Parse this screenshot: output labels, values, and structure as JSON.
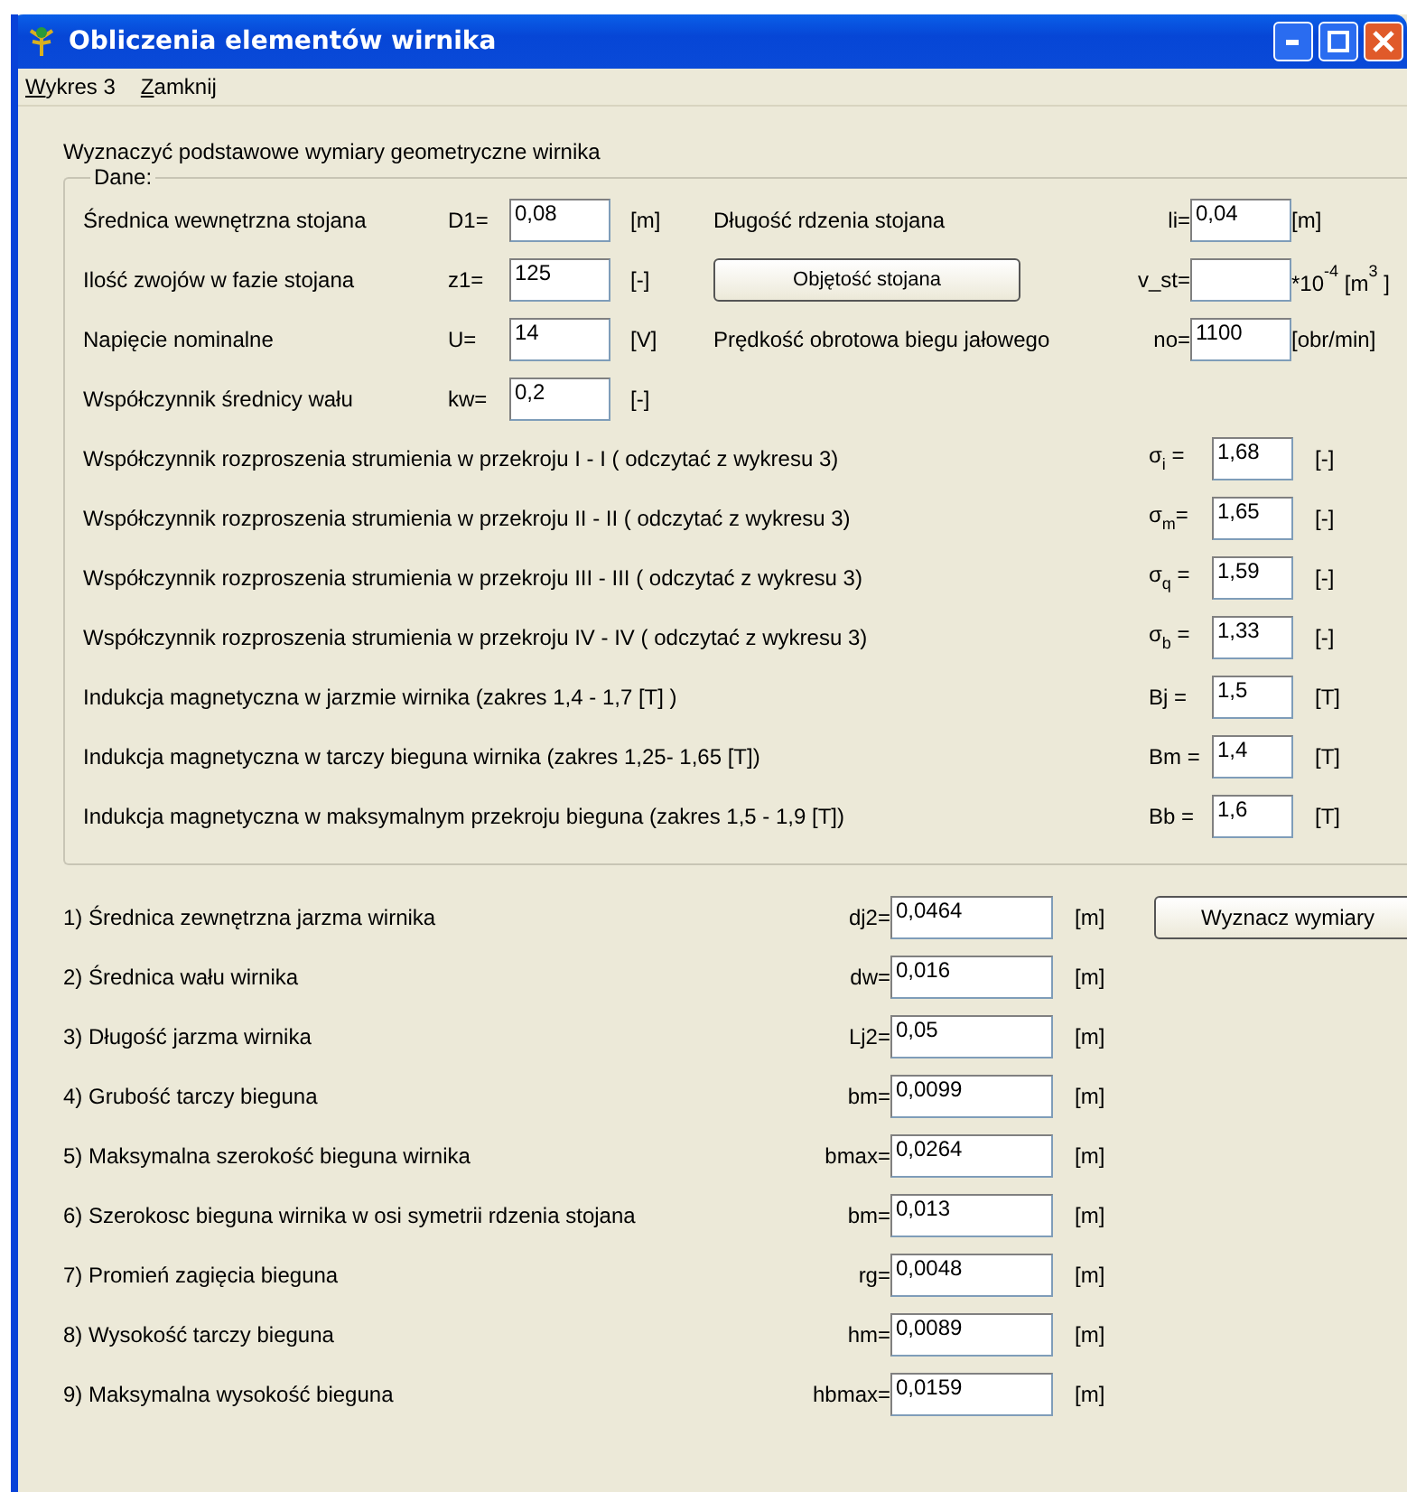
{
  "window": {
    "title": "Obliczenia elementów wirnika"
  },
  "menu": [
    {
      "label": "Wykres 3"
    },
    {
      "label": "Zamknij"
    }
  ],
  "heading": "Wyznaczyć podstawowe wymiary geometryczne wirnika",
  "group": {
    "title": "Dane:",
    "top_rows": [
      {
        "label": "Średnica wewnętrzna stojana",
        "symbol": "D1=",
        "value": "0,08",
        "unit": "[m]",
        "right": {
          "kind": "field",
          "label": "Długość rdzenia stojana",
          "symbol": "li=",
          "value": "0,04",
          "unit": "[m]"
        }
      },
      {
        "label": "Ilość zwojów w fazie stojana",
        "symbol": "z1=",
        "value": "125",
        "unit": "[-]",
        "right": {
          "kind": "button",
          "label": "Objętość stojana",
          "symbol": "v_st=",
          "unit": "*10$^{-4}$ [m$^{3}$ ]"
        }
      },
      {
        "label": "Napięcie nominalne",
        "symbol": "U=",
        "value": "14",
        "unit": "[V]",
        "right": {
          "kind": "field",
          "label": "Prędkość obrotowa biegu jałowego",
          "symbol": "no=",
          "value": "1100",
          "unit": "[obr/min]"
        }
      },
      {
        "label": "Współczynnik średnicy wału",
        "symbol": "kw=",
        "value": "0,2",
        "unit": "[-]"
      }
    ],
    "coefficient_rows": [
      {
        "label": "Współczynnik rozproszenia strumienia w przekroju I - I ( odczytać z wykresu 3)",
        "symbol": "σ$_{i}$ =",
        "value": "1,68",
        "unit": "[-]"
      },
      {
        "label": "Współczynnik rozproszenia strumienia w przekroju II - II ( odczytać z wykresu 3)",
        "symbol": "σ$_{m}$=",
        "value": "1,65",
        "unit": "[-]"
      },
      {
        "label": "Współczynnik rozproszenia strumienia w przekroju III - III ( odczytać z wykresu 3)",
        "symbol": "σ$_{q}$ =",
        "value": "1,59",
        "unit": "[-]"
      },
      {
        "label": "Współczynnik rozproszenia strumienia w przekroju IV - IV ( odczytać z wykresu 3)",
        "symbol": "σ$_{b}$ =",
        "value": "1,33",
        "unit": "[-]"
      },
      {
        "label": "Indukcja magnetyczna w jarzmie wirnika (zakres 1,4 - 1,7 [T] )",
        "symbol": "Bj =",
        "value": "1,5",
        "unit": "[T]"
      },
      {
        "label": "Indukcja magnetyczna w tarczy bieguna wirnika (zakres 1,25- 1,65 [T])",
        "symbol": "Bm =",
        "value": "1,4",
        "unit": "[T]"
      },
      {
        "label": "Indukcja magnetyczna w maksymalnym przekroju bieguna (zakres 1,5 - 1,9 [T])",
        "symbol": "Bb =",
        "value": "1,6",
        "unit": "[T]"
      }
    ]
  },
  "results": {
    "button": "Wyznacz wymiary",
    "rows": [
      {
        "label": "1) Średnica zewnętrzna jarzma wirnika",
        "symbol": "dj2=",
        "value": "0,0464",
        "unit": "[m]"
      },
      {
        "label": "2) Średnica wału wirnika",
        "symbol": "dw=",
        "value": "0,016",
        "unit": "[m]"
      },
      {
        "label": "3) Długość jarzma  wirnika",
        "symbol": "Lj2=",
        "value": "0,05",
        "unit": "[m]"
      },
      {
        "label": "4) Grubość tarczy bieguna",
        "symbol": "bm=",
        "value": "0,0099",
        "unit": "[m]"
      },
      {
        "label": "5) Maksymalna szerokość bieguna wirnika",
        "symbol": "bmax=",
        "value": "0,0264",
        "unit": "[m]"
      },
      {
        "label": "6) Szerokosc bieguna wirnika w osi symetrii rdzenia stojana",
        "symbol": "bm=",
        "value": "0,013",
        "unit": "[m]"
      },
      {
        "label": "7) Promień zagięcia bieguna",
        "symbol": "rg=",
        "value": "0,0048",
        "unit": "[m]"
      },
      {
        "label": "8) Wysokość tarczy bieguna",
        "symbol": "hm=",
        "value": "0,0089",
        "unit": "[m]"
      },
      {
        "label": "9) Maksymalna wysokość bieguna",
        "symbol": "hbmax=",
        "value": "0,0159",
        "unit": "[m]"
      }
    ]
  }
}
